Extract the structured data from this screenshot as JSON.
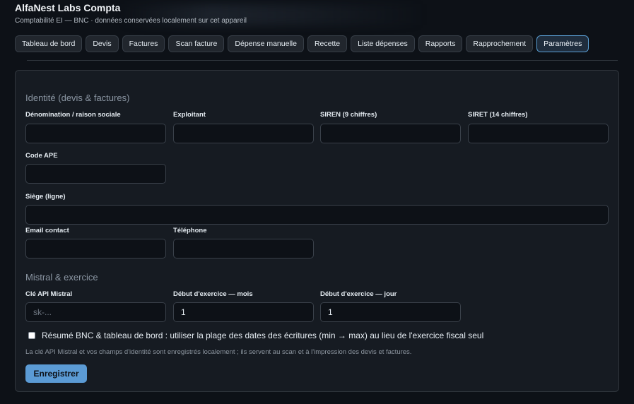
{
  "app": {
    "title": "AlfaNest Labs Compta",
    "subtitle": "Comptabilité EI — BNC · données conservées localement sur cet appareil"
  },
  "tabs": [
    {
      "label": "Tableau de bord"
    },
    {
      "label": "Devis"
    },
    {
      "label": "Factures"
    },
    {
      "label": "Scan facture"
    },
    {
      "label": "Dépense manuelle"
    },
    {
      "label": "Recette"
    },
    {
      "label": "Liste dépenses"
    },
    {
      "label": "Rapports"
    },
    {
      "label": "Rapprochement"
    },
    {
      "label": "Paramètres",
      "active": true
    }
  ],
  "identity": {
    "title": "Identité (devis & factures)",
    "fields": {
      "denomination": {
        "label": "Dénomination / raison sociale",
        "value": ""
      },
      "exploitant": {
        "label": "Exploitant",
        "value": ""
      },
      "siren": {
        "label": "SIREN (9 chiffres)",
        "value": ""
      },
      "siret": {
        "label": "SIRET (14 chiffres)",
        "value": ""
      },
      "ape": {
        "label": "Code APE",
        "value": ""
      },
      "siege": {
        "label": "Siège (ligne)",
        "value": ""
      },
      "email": {
        "label": "Email contact",
        "value": ""
      },
      "telephone": {
        "label": "Téléphone",
        "value": ""
      }
    }
  },
  "mistral": {
    "title": "Mistral & exercice",
    "fields": {
      "api_key": {
        "label": "Clé API Mistral",
        "value": "",
        "placeholder": "sk-..."
      },
      "start_month": {
        "label": "Début d'exercice — mois",
        "value": "1"
      },
      "start_day": {
        "label": "Début d'exercice — jour",
        "value": "1"
      }
    }
  },
  "options": {
    "use_entry_range": {
      "label": "Résumé BNC & tableau de bord : utiliser la plage des dates des écritures (min → max) au lieu de l'exercice fiscal seul",
      "checked": false
    }
  },
  "note": "La clé API Mistral et vos champs d'identité sont enregistrés localement ; ils servent au scan et à l'impression des devis et factures.",
  "actions": {
    "save_label": "Enregistrer"
  },
  "colors": {
    "background": "#0d1117",
    "panel": "#161b22",
    "accent": "#5b9bd5"
  }
}
